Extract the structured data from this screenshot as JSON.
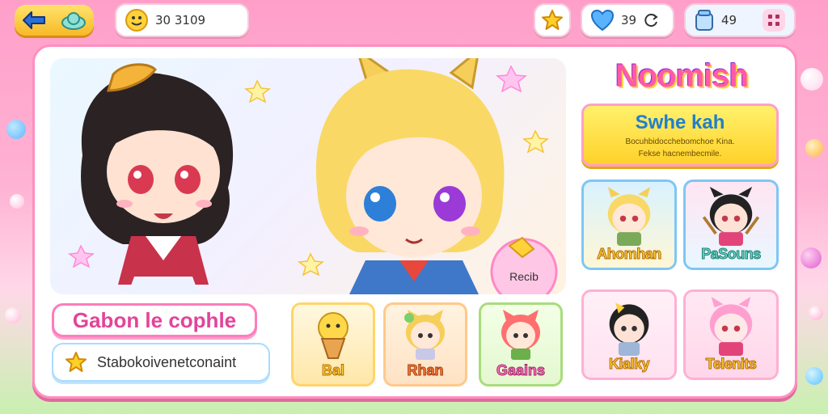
{
  "topbar": {
    "coins": "30 3109",
    "hearts": "39",
    "inventory": "49"
  },
  "panel": {
    "game_title": "Noomish",
    "banner_title": "Swhe kah",
    "banner_text_line1": "Bocuhbidocchebomchoe Kina.",
    "banner_text_line2": "Fekse hacnembecmile.",
    "character_cards": [
      {
        "label": "Ahomhan"
      },
      {
        "label": "PaSouns"
      },
      {
        "label": "Kialky"
      },
      {
        "label": "Telenits"
      }
    ],
    "hero_badge": "Recib",
    "section_title": "Gabon le cophle",
    "status_text": "Stabokoivenetconaint",
    "bottom_cards": [
      {
        "label": "Bal"
      },
      {
        "label": "Rhan"
      },
      {
        "label": "Gaains"
      }
    ]
  }
}
